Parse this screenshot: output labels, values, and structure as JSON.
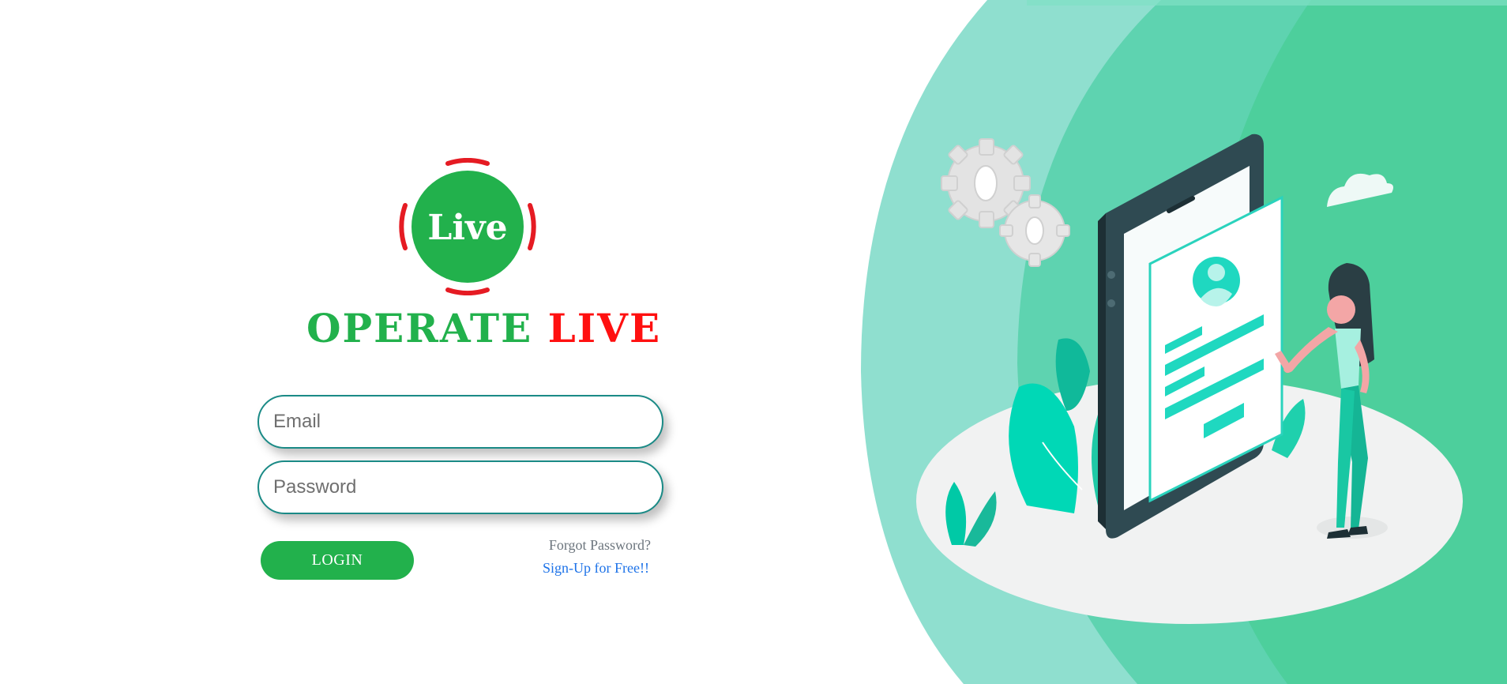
{
  "logo": {
    "badge_text": "Live",
    "brand_word_1": "OPERATE",
    "brand_word_2": "LIVE",
    "colors": {
      "green": "#22b14c",
      "red": "#ff1010"
    }
  },
  "form": {
    "email_placeholder": "Email",
    "password_placeholder": "Password",
    "email_value": "",
    "password_value": "",
    "login_label": "LOGIN",
    "forgot_label": "Forgot Password?",
    "signup_label": "Sign-Up for Free!!"
  },
  "illustration": {
    "subject": "woman-interacting-with-smartphone-profile-illustration",
    "colors": {
      "background_teal_light": "#8fdfcf",
      "background_teal": "#5ed3b0",
      "background_teal_dark": "#4dcf9c",
      "accent": "#1fd8c0",
      "phone": "#2f4a52"
    }
  }
}
